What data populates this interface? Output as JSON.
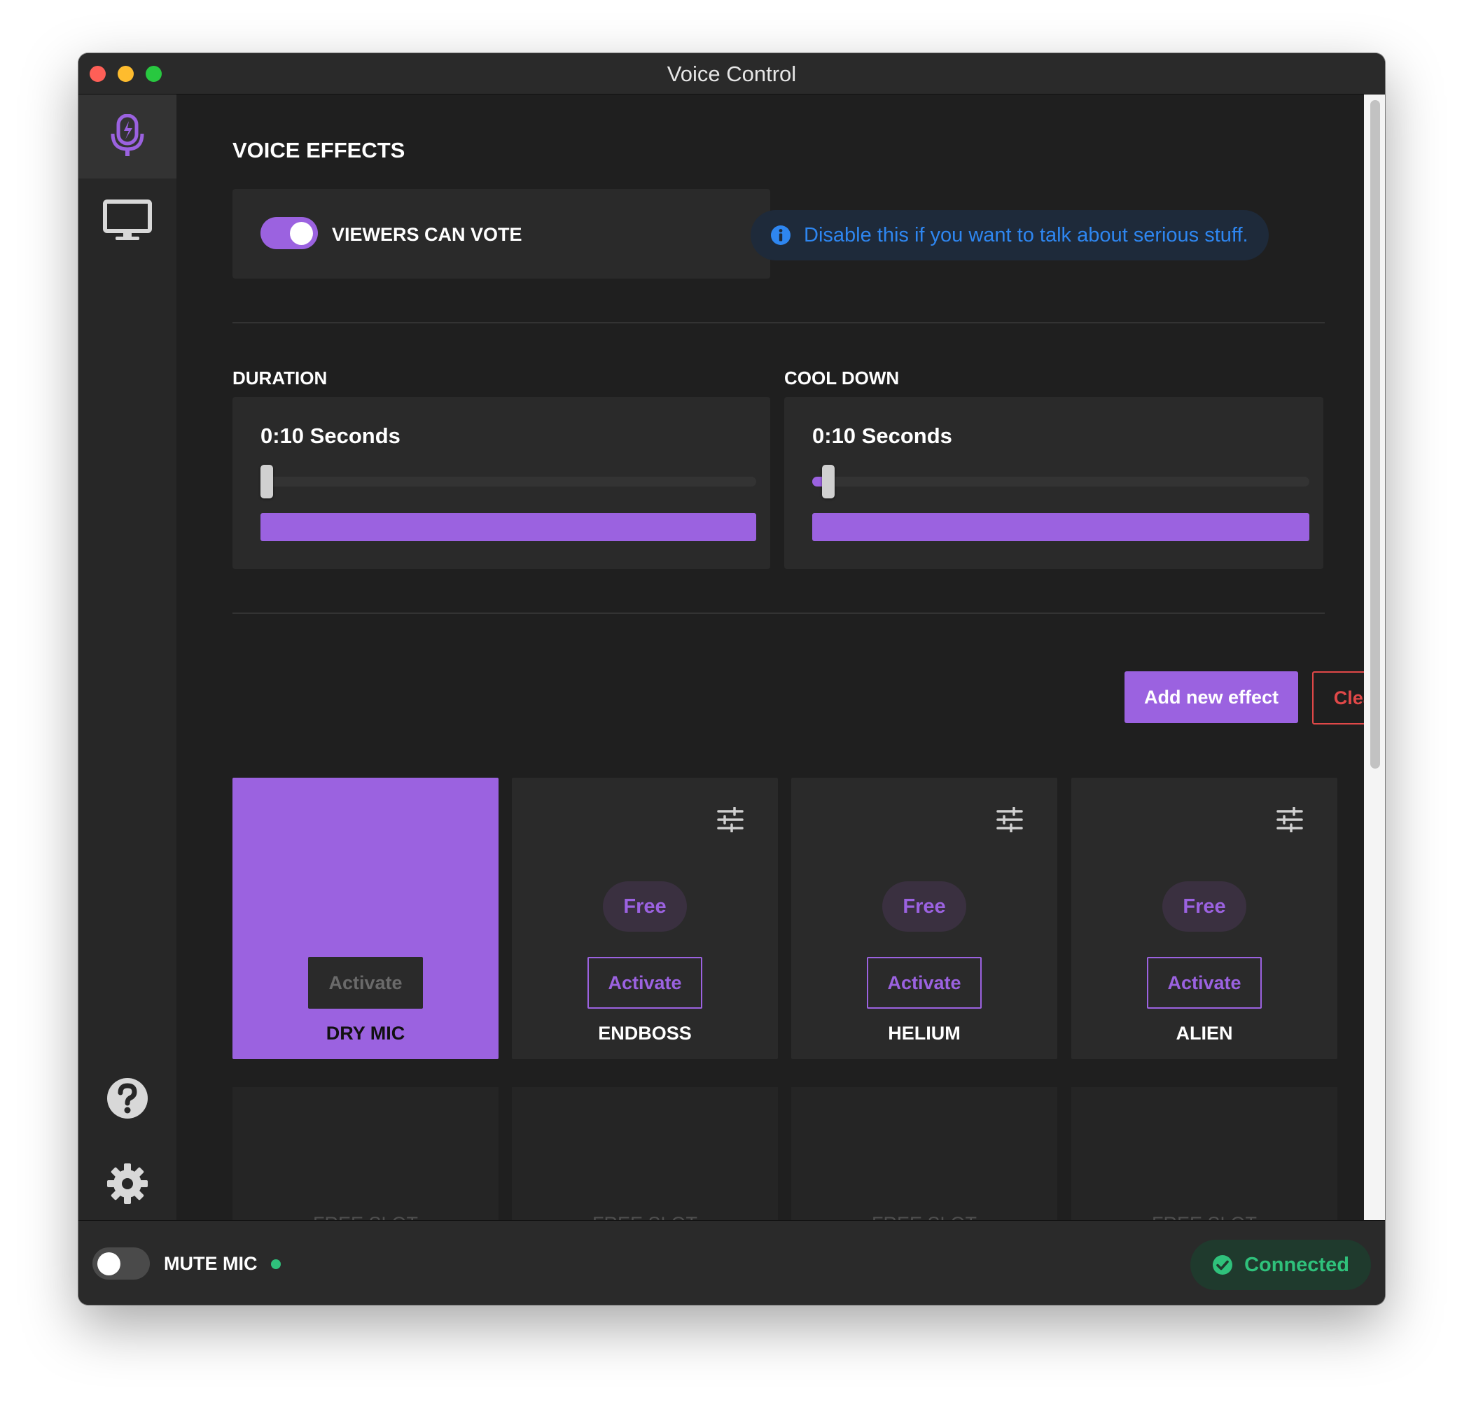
{
  "window": {
    "title": "Voice Control"
  },
  "sidebar": {
    "items": [
      {
        "icon": "microphone-icon",
        "active": true
      },
      {
        "icon": "monitor-icon",
        "active": false
      },
      {
        "icon": "help-icon",
        "active": false
      },
      {
        "icon": "gear-icon",
        "active": false
      }
    ]
  },
  "main": {
    "heading": "VOICE EFFECTS",
    "vote_toggle": {
      "label": "VIEWERS CAN VOTE",
      "on": true
    },
    "info": {
      "icon": "info-icon",
      "text": "Disable this if you want to talk about serious stuff."
    },
    "duration": {
      "label": "DURATION",
      "value": "0:10 Seconds",
      "level": 0.0
    },
    "cooldown": {
      "label": "COOL DOWN",
      "value": "0:10 Seconds",
      "level": 0.02
    },
    "actions": {
      "add_label": "Add new effect",
      "clear_label": "Clear"
    },
    "effects": [
      {
        "name": "DRY MIC",
        "activate_label": "Activate",
        "active": true
      },
      {
        "name": "ENDBOSS",
        "badge": "Free",
        "activate_label": "Activate",
        "active": false
      },
      {
        "name": "HELIUM",
        "badge": "Free",
        "activate_label": "Activate",
        "active": false
      },
      {
        "name": "ALIEN",
        "badge": "Free",
        "activate_label": "Activate",
        "active": false
      }
    ],
    "free_slots": [
      "FREE SLOT",
      "FREE SLOT",
      "FREE SLOT",
      "FREE SLOT"
    ]
  },
  "footer": {
    "mute_label": "MUTE MIC",
    "mute_on": false,
    "status_text": "Connected"
  },
  "colors": {
    "accent": "#9b62e0",
    "danger": "#e04848",
    "info": "#2e86f0",
    "success": "#2fc17b"
  }
}
